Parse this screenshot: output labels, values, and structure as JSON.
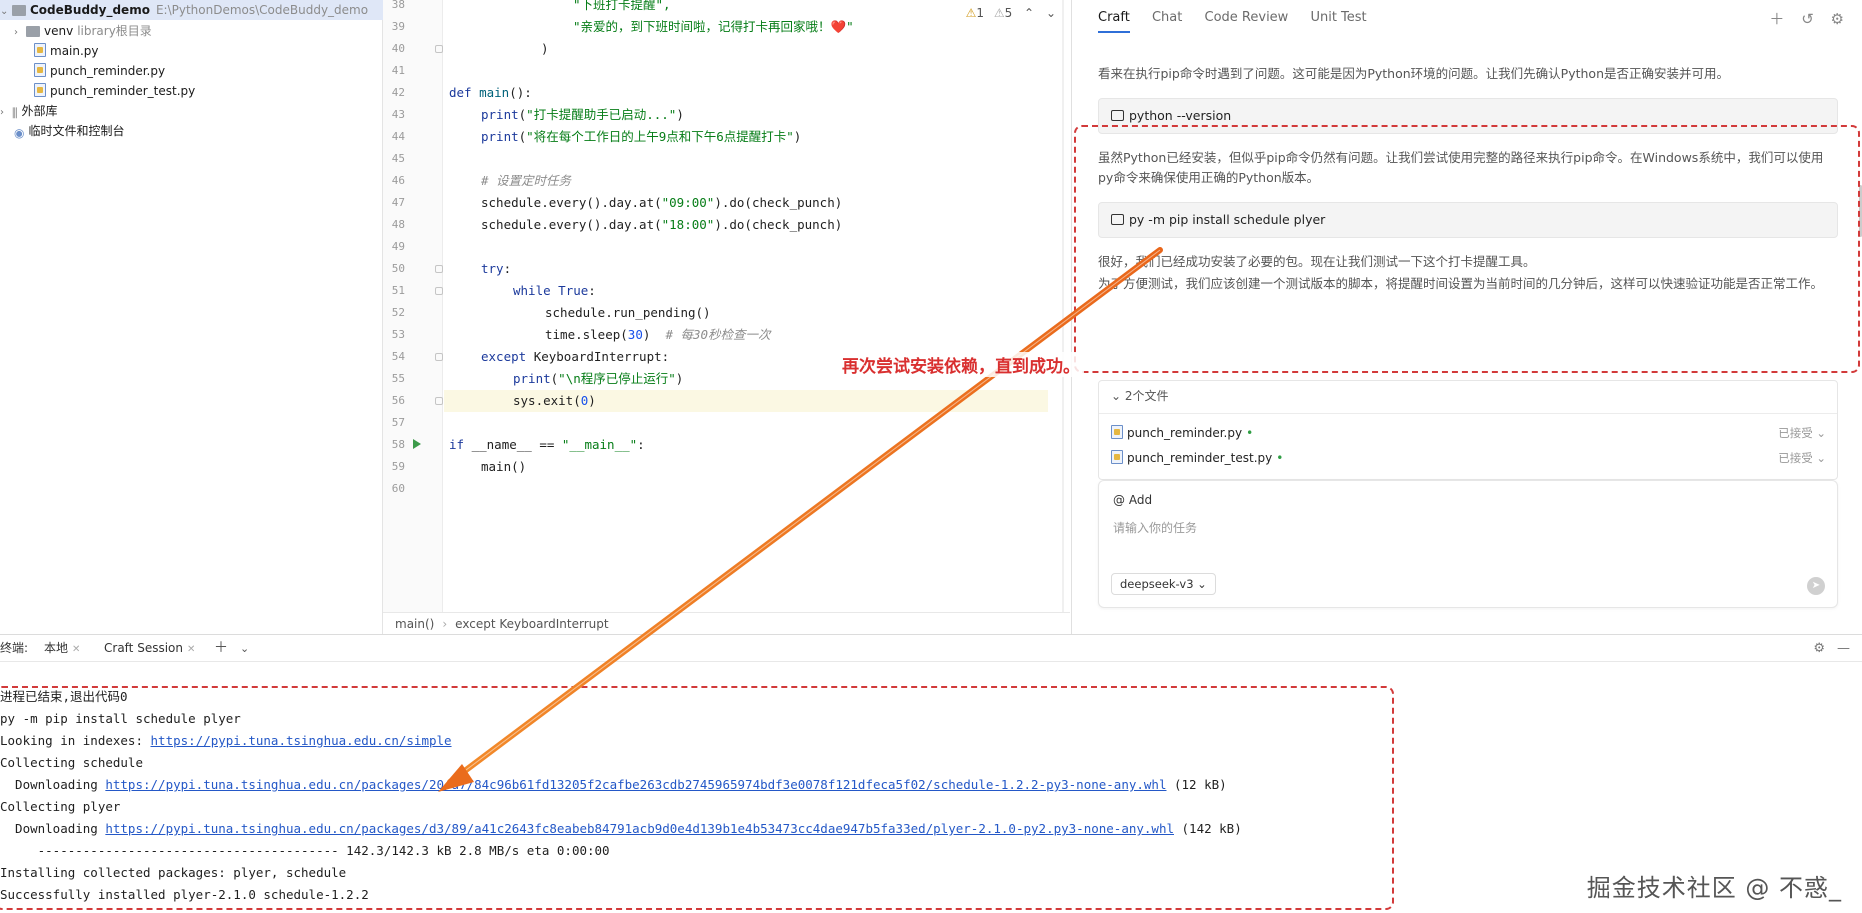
{
  "project": {
    "root_name": "CodeBuddy_demo",
    "root_path": "E:\\PythonDemos\\CodeBuddy_demo",
    "items": [
      {
        "label": "venv",
        "note": "library根目录"
      },
      {
        "label": "main.py"
      },
      {
        "label": "punch_reminder.py"
      },
      {
        "label": "punch_reminder_test.py"
      },
      {
        "label": "外部库"
      },
      {
        "label": "临时文件和控制台"
      }
    ]
  },
  "editor": {
    "inspections": {
      "warnings": "1",
      "weak": "5"
    },
    "line_numbers": [
      "38",
      "39",
      "40",
      "41",
      "42",
      "43",
      "44",
      "45",
      "46",
      "47",
      "48",
      "49",
      "50",
      "51",
      "52",
      "53",
      "54",
      "55",
      "56",
      "57",
      "58",
      "59",
      "60"
    ],
    "code": {
      "l38": "\"下班打卡提醒\",",
      "l39": "\"亲爱的，到下班时间啦，记得打卡再回家哦！❤️\"",
      "l40": ")",
      "l42_kw": "def",
      "l42_fn": "main",
      "l42_rest": "():",
      "l43_fn": "print",
      "l43_str": "\"打卡提醒助手已启动...\"",
      "l44_fn": "print",
      "l44_str": "\"将在每个工作日的上午9点和下午6点提醒打卡\"",
      "l46": "# 设置定时任务",
      "l47_a": "schedule.every().day.at(",
      "l47_str": "\"09:00\"",
      "l47_b": ").do(check_punch)",
      "l48_a": "schedule.every().day.at(",
      "l48_str": "\"18:00\"",
      "l48_b": ").do(check_punch)",
      "l50_kw": "try",
      "l51_kw": "while",
      "l51_val": "True",
      "l52": "schedule.run_pending()",
      "l53_a": "time.sleep(",
      "l53_num": "30",
      "l53_b": ")",
      "l53_cm": "# 每30秒检查一次",
      "l54_kw": "except",
      "l54_rest": "KeyboardInterrupt:",
      "l55_fn": "print",
      "l55_str": "\"\\n程序已停止运行\"",
      "l56_a": "sys.exit(",
      "l56_num": "0",
      "l56_b": ")",
      "l58_kw": "if",
      "l58_rest": "__name__ == ",
      "l58_str": "\"__main__\"",
      "l59": "main()"
    },
    "breadcrumb": [
      "main()",
      "except KeyboardInterrupt"
    ]
  },
  "craft": {
    "tabs": [
      "Craft",
      "Chat",
      "Code Review",
      "Unit Test"
    ],
    "messages": {
      "m1": "看来在执行pip命令时遇到了问题。这可能是因为Python环境的问题。让我们先确认Python是否正确安装并可用。",
      "cmd1": "python --version",
      "m2": "虽然Python已经安装，但似乎pip命令仍然有问题。让我们尝试使用完整的路径来执行pip命令。在Windows系统中，我们可以使用py命令来确保使用正确的Python版本。",
      "cmd2": "py -m pip install schedule plyer",
      "m3": "很好，我们已经成功安装了必要的包。现在让我们测试一下这个打卡提醒工具。",
      "m4": "为了方便测试，我们应该创建一个测试版本的脚本，将提醒时间设置为当前时间的几分钟后，这样可以快速验证功能是否正常工作。"
    },
    "files_header": "2个文件",
    "files": [
      {
        "name": "punch_reminder.py",
        "status": "已接受"
      },
      {
        "name": "punch_reminder_test.py",
        "status": "已接受"
      }
    ],
    "input": {
      "add_label": "Add",
      "placeholder": "请输入你的任务",
      "model": "deepseek-v3"
    }
  },
  "run": {
    "label": "终端:",
    "tabs": [
      "本地",
      "Craft Session"
    ],
    "console": {
      "l1": "进程已结束,退出代码0",
      "l2": "py -m pip install schedule plyer",
      "l3_a": "Looking in indexes: ",
      "l3_link": "https://pypi.tuna.tsinghua.edu.cn/simple",
      "l4": "Collecting schedule",
      "l5_a": "  Downloading ",
      "l5_link": "https://pypi.tuna.tsinghua.edu.cn/packages/20/a7/84c96b61fd13205f2cafbe263cdb2745965974bdf3e0078f121dfeca5f02/schedule-1.2.2-py3-none-any.whl",
      "l5_b": " (12 kB)",
      "l6": "Collecting plyer",
      "l7_a": "  Downloading ",
      "l7_link": "https://pypi.tuna.tsinghua.edu.cn/packages/d3/89/a41c2643fc8eabeb84791acb9d0e4d139b1e4b53473cc4dae947b5fa33ed/plyer-2.1.0-py2.py3-none-any.whl",
      "l7_b": " (142 kB)",
      "l8": "     ---------------------------------------- 142.3/142.3 kB 2.8 MB/s eta 0:00:00",
      "l9": "Installing collected packages: plyer, schedule",
      "l10": "Successfully installed plyer-2.1.0 schedule-1.2.2"
    }
  },
  "annotation": {
    "text": "再次尝试安装依赖，直到成功。",
    "color": "#d93030",
    "arrow_color": "#f07a1a"
  },
  "watermark": "掘金技术社区 @ 不惑_"
}
